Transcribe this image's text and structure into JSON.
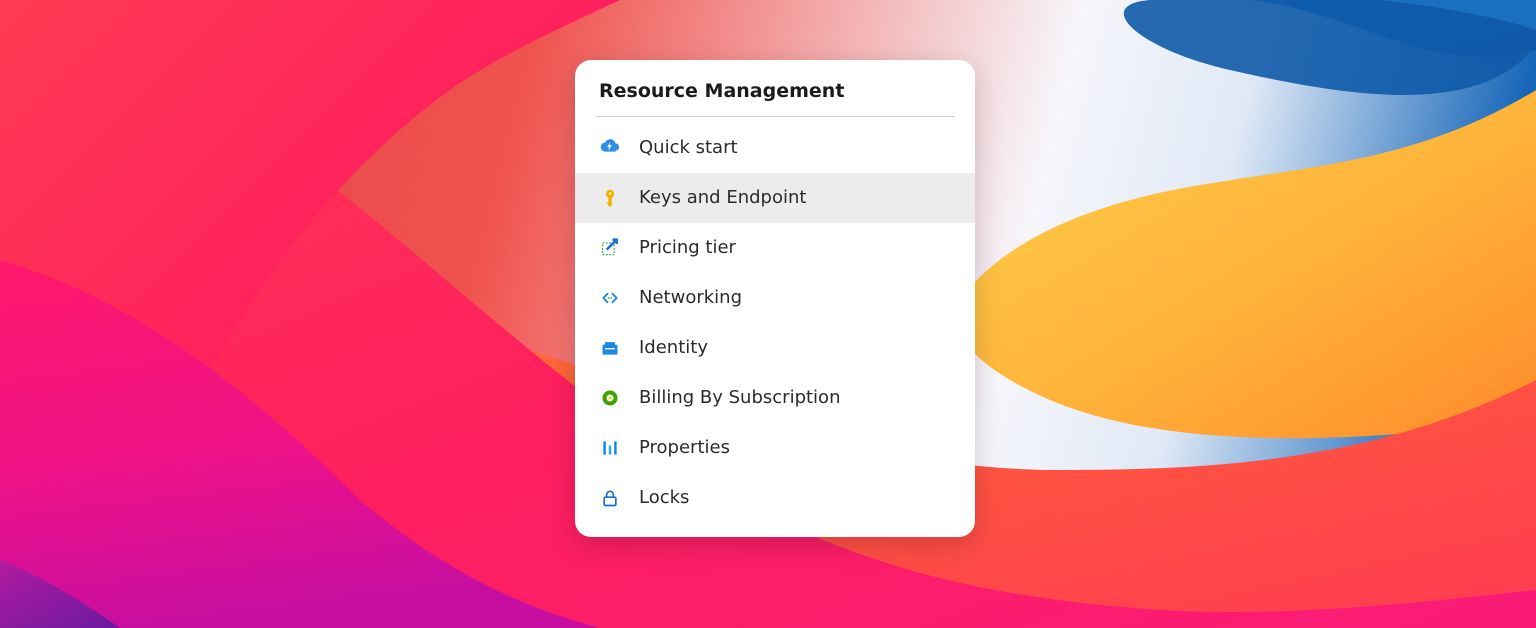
{
  "menu": {
    "title": "Resource Management",
    "selectedIndex": 1,
    "items": [
      {
        "label": "Quick start"
      },
      {
        "label": "Keys and Endpoint"
      },
      {
        "label": "Pricing tier"
      },
      {
        "label": "Networking"
      },
      {
        "label": "Identity"
      },
      {
        "label": "Billing By Subscription"
      },
      {
        "label": "Properties"
      },
      {
        "label": "Locks"
      }
    ]
  }
}
